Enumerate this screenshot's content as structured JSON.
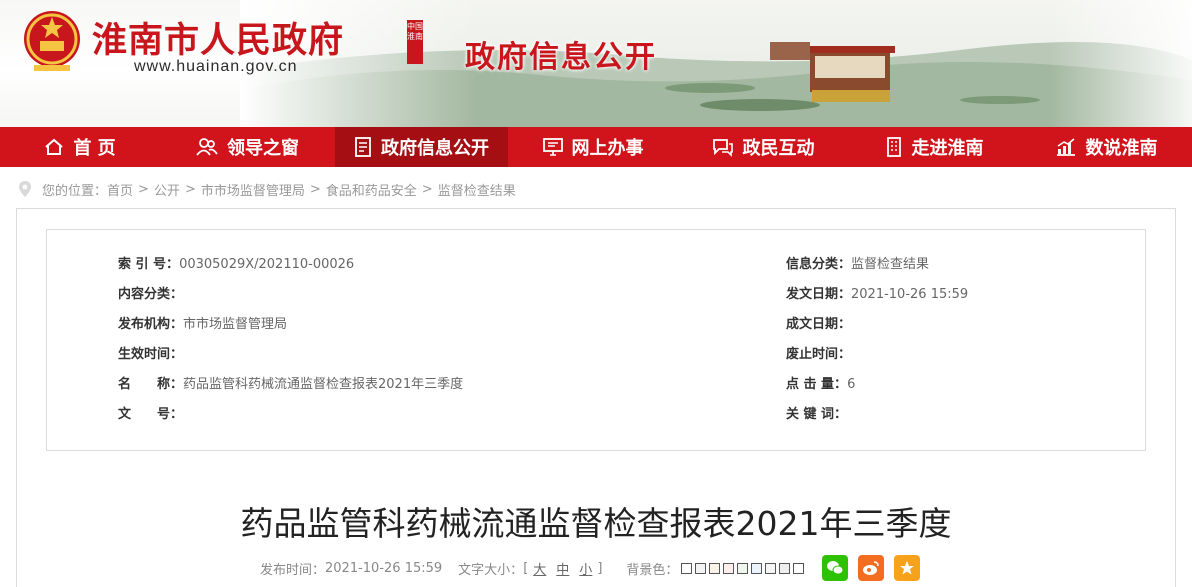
{
  "header": {
    "site_title": "淮南市人民政府",
    "site_url": "www.huainan.gov.cn",
    "seal_text": "中国淮南",
    "section_title": "政府信息公开"
  },
  "nav": {
    "items": [
      {
        "label": "首 页",
        "icon": "home-icon"
      },
      {
        "label": "领导之窗",
        "icon": "people-icon"
      },
      {
        "label": "政府信息公开",
        "icon": "document-icon",
        "active": true
      },
      {
        "label": "网上办事",
        "icon": "monitor-icon"
      },
      {
        "label": "政民互动",
        "icon": "chat-icon"
      },
      {
        "label": "走进淮南",
        "icon": "building-icon"
      },
      {
        "label": "数说淮南",
        "icon": "chart-icon"
      }
    ]
  },
  "breadcrumb": {
    "prefix": "您的位置：",
    "items": [
      "首页",
      "公开",
      "市市场监督管理局",
      "食品和药品安全",
      "监督检查结果"
    ],
    "separator": ">"
  },
  "meta": {
    "index_label": "索 引 号：",
    "index_value": "00305029X/202110-00026",
    "category_label": "信息分类：",
    "category_value": "监督检查结果",
    "content_type_label": "内容分类：",
    "content_type_value": "",
    "publish_date_label": "发文日期：",
    "publish_date_value": "2021-10-26 15:59",
    "issuer_label": "发布机构：",
    "issuer_value": "市市场监督管理局",
    "created_date_label": "成文日期：",
    "created_date_value": "",
    "effective_label": "生效时间：",
    "effective_value": "",
    "abolished_label": "废止时间：",
    "abolished_value": "",
    "name_label": "名　　称：",
    "name_value": "药品监管科药械流通监督检查报表2021年三季度",
    "clicks_label": "点 击 量：",
    "clicks_value": "6",
    "doc_no_label": "文　　号：",
    "doc_no_value": "",
    "keywords_label": "关 键 词：",
    "keywords_value": ""
  },
  "article": {
    "title": "药品监管科药械流通监督检查报表2021年三季度",
    "publish_time_label": "发布时间：",
    "publish_time": "2021-10-26 15:59",
    "font_size_label": "文字大小：",
    "font_size_open": "[",
    "font_sizes": [
      "大",
      "中",
      "小"
    ],
    "font_size_close": "]",
    "bg_color_label": "背景色："
  },
  "colors": {
    "brand_red": "#d1141b",
    "active_nav": "#a50f14",
    "swatches": [
      "#ffffff",
      "#f3f3f3",
      "#faf3e6",
      "#ffeeee",
      "#eef6ee",
      "#e9f4fb",
      "#f5f5f5",
      "#eeeeee",
      "#ffffff"
    ],
    "wechat": "#2dc100",
    "weibo": "#f26d22",
    "favorite": "#f7a21b"
  },
  "share": [
    {
      "name": "wechat-share-icon"
    },
    {
      "name": "weibo-share-icon"
    },
    {
      "name": "favorite-icon"
    }
  ]
}
